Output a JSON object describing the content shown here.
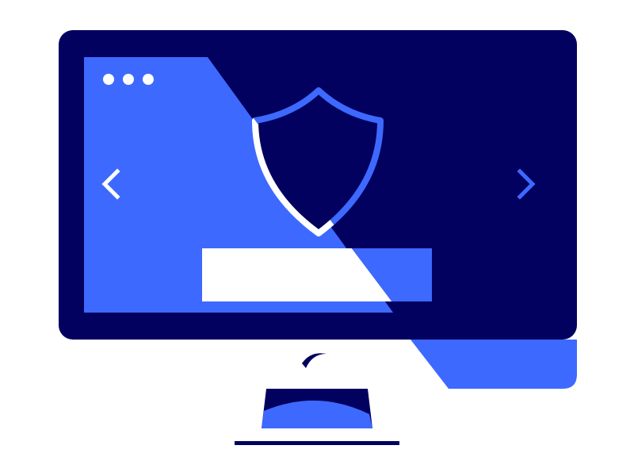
{
  "illustration": {
    "subject": "monitor-with-security-shield",
    "colors": {
      "navy": "#03015f",
      "blue": "#3d69ff",
      "white": "#ffffff"
    },
    "icons": [
      "window-dots-icon",
      "chevron-left-icon",
      "chevron-right-icon",
      "shield-icon"
    ]
  }
}
